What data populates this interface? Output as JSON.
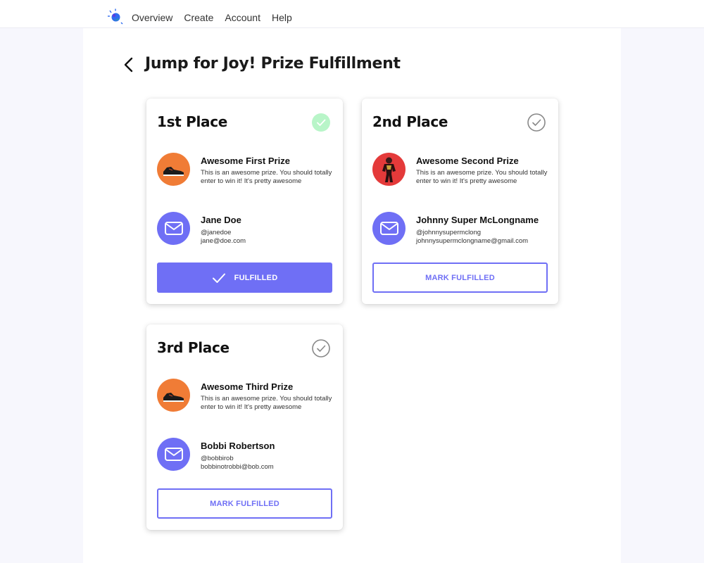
{
  "nav": {
    "items": [
      "Overview",
      "Create",
      "Account",
      "Help"
    ]
  },
  "page": {
    "title": "Jump for Joy! Prize Fulfillment"
  },
  "colors": {
    "accent": "#6f6ff5",
    "fulfilled_check": "#b8f5c8",
    "pending_check": "#888888",
    "prize_orange": "#f07c36"
  },
  "cards": [
    {
      "place": "1st Place",
      "status": "fulfilled",
      "status_icon": "check-circle-filled-icon",
      "prize": {
        "name": "Awesome First Prize",
        "description": "This is an awesome prize. You should totally enter to win it! It's pretty awesome",
        "icon": "sneaker-icon"
      },
      "winner": {
        "name": "Jane Doe",
        "handle": "@janedoe",
        "email": "jane@doe.com"
      },
      "button": {
        "label": "FULFILLED"
      }
    },
    {
      "place": "2nd Place",
      "status": "pending",
      "status_icon": "check-circle-outline-icon",
      "prize": {
        "name": "Awesome Second Prize",
        "description": "This is an awesome prize. You should totally enter to win it! It's pretty awesome",
        "icon": "armored-figure-icon"
      },
      "winner": {
        "name": "Johnny Super McLongname",
        "handle": "@johnnysupermclong",
        "email": "johnnysupermclongname@gmail.com"
      },
      "button": {
        "label": "MARK FULFILLED"
      }
    },
    {
      "place": "3rd Place",
      "status": "pending",
      "status_icon": "check-circle-outline-icon",
      "prize": {
        "name": "Awesome Third Prize",
        "description": "This is an awesome prize. You should totally enter to win it! It's pretty awesome",
        "icon": "sneaker-icon"
      },
      "winner": {
        "name": "Bobbi Robertson",
        "handle": "@bobbirob",
        "email": "bobbinotrobbi@bob.com"
      },
      "button": {
        "label": "MARK FULFILLED"
      }
    }
  ]
}
